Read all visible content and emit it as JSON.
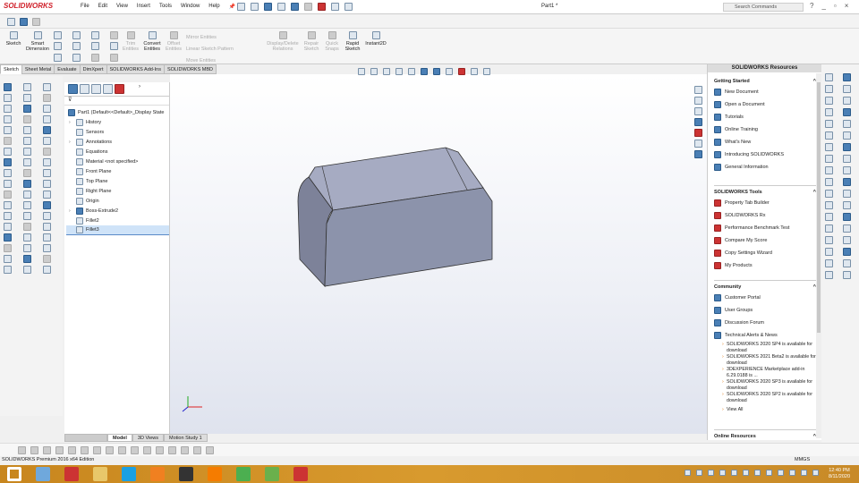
{
  "app": {
    "logo": "SOLIDWORKS",
    "doc_title": "Part1 *",
    "search_placeholder": "Search Commands"
  },
  "menu": [
    "File",
    "Edit",
    "View",
    "Insert",
    "Tools",
    "Window",
    "Help"
  ],
  "commands": [
    {
      "label": "Sketch",
      "disabled": false
    },
    {
      "label": "Smart Dimension",
      "disabled": false
    },
    {
      "label": "Trim Entities",
      "disabled": true
    },
    {
      "label": "Convert Entities",
      "disabled": false
    },
    {
      "label": "Offset Entities",
      "disabled": true
    },
    {
      "label": "Mirror Entities",
      "disabled": true
    },
    {
      "label": "Linear Sketch Pattern",
      "disabled": true
    },
    {
      "label": "Move Entities",
      "disabled": true
    },
    {
      "label": "Display/Delete Relations",
      "disabled": true
    },
    {
      "label": "Repair Sketch",
      "disabled": true
    },
    {
      "label": "Quick Snaps",
      "disabled": true
    },
    {
      "label": "Rapid Sketch",
      "disabled": false
    },
    {
      "label": "Instant2D",
      "disabled": false
    }
  ],
  "tabs": [
    {
      "label": "Sketch",
      "active": true
    },
    {
      "label": "Sheet Metal"
    },
    {
      "label": "Evaluate"
    },
    {
      "label": "DimXpert"
    },
    {
      "label": "SOLIDWORKS Add-Ins"
    },
    {
      "label": "SOLIDWORKS MBD"
    }
  ],
  "feature_tree": {
    "root": "Part1  (Default<<Default>_Display State",
    "items": [
      {
        "label": "History",
        "expand": true
      },
      {
        "label": "Sensors"
      },
      {
        "label": "Annotations",
        "expand": true
      },
      {
        "label": "Equations"
      },
      {
        "label": "Material <not specified>"
      },
      {
        "label": "Front Plane"
      },
      {
        "label": "Top Plane"
      },
      {
        "label": "Right Plane"
      },
      {
        "label": "Origin"
      },
      {
        "label": "Boss-Extrude2",
        "expand": true
      },
      {
        "label": "Fillet2"
      },
      {
        "label": "Fillet3",
        "selected": true
      }
    ]
  },
  "resources": {
    "title": "SOLIDWORKS Resources",
    "getting_started": {
      "title": "Getting Started",
      "items": [
        "New Document",
        "Open a Document",
        "Tutorials",
        "Online Training",
        "What's New",
        "Introducing SOLIDWORKS",
        "General Information"
      ]
    },
    "tools": {
      "title": "SOLIDWORKS Tools",
      "items": [
        "Property Tab Builder",
        "SOLIDWORKS Rx",
        "Performance Benchmark Test",
        "Compare My Score",
        "Copy Settings Wizard",
        "My Products"
      ]
    },
    "community": {
      "title": "Community",
      "items": [
        "Customer Portal",
        "User Groups",
        "Discussion Forum",
        "Technical Alerts & News"
      ],
      "news": [
        "SOLIDWORKS 2020 SP4 is available for download",
        "SOLIDWORKS 2021 Beta2 is available for download",
        "3DEXPERIENCE Marketplace add-in 6.29.0188 is ...",
        "SOLIDWORKS 2020 SP3 is available for download",
        "SOLIDWORKS 2020 SP2 is available for download"
      ],
      "view_all": "View All"
    },
    "online": {
      "title": "Online Resources"
    }
  },
  "bottom_tabs": [
    {
      "label": "Model",
      "active": true
    },
    {
      "label": "3D Views"
    },
    {
      "label": "Motion Study 1"
    }
  ],
  "status": {
    "text": "SOLIDWORKS Premium 2016 x64 Edition",
    "units": "MMGS"
  },
  "taskbar": {
    "time": "12:40 PM",
    "date": "8/11/2020",
    "apps": [
      "windows-start",
      "calculator",
      "solidworks-2016",
      "file-explorer",
      "cisco",
      "app-orange",
      "inkscape",
      "vlc",
      "chrome",
      "utorrent",
      "solidworks-2016-active"
    ]
  },
  "colors": {
    "accent": "#d0202a",
    "model": "#8c93ab",
    "taskbar": "#d0922a"
  }
}
